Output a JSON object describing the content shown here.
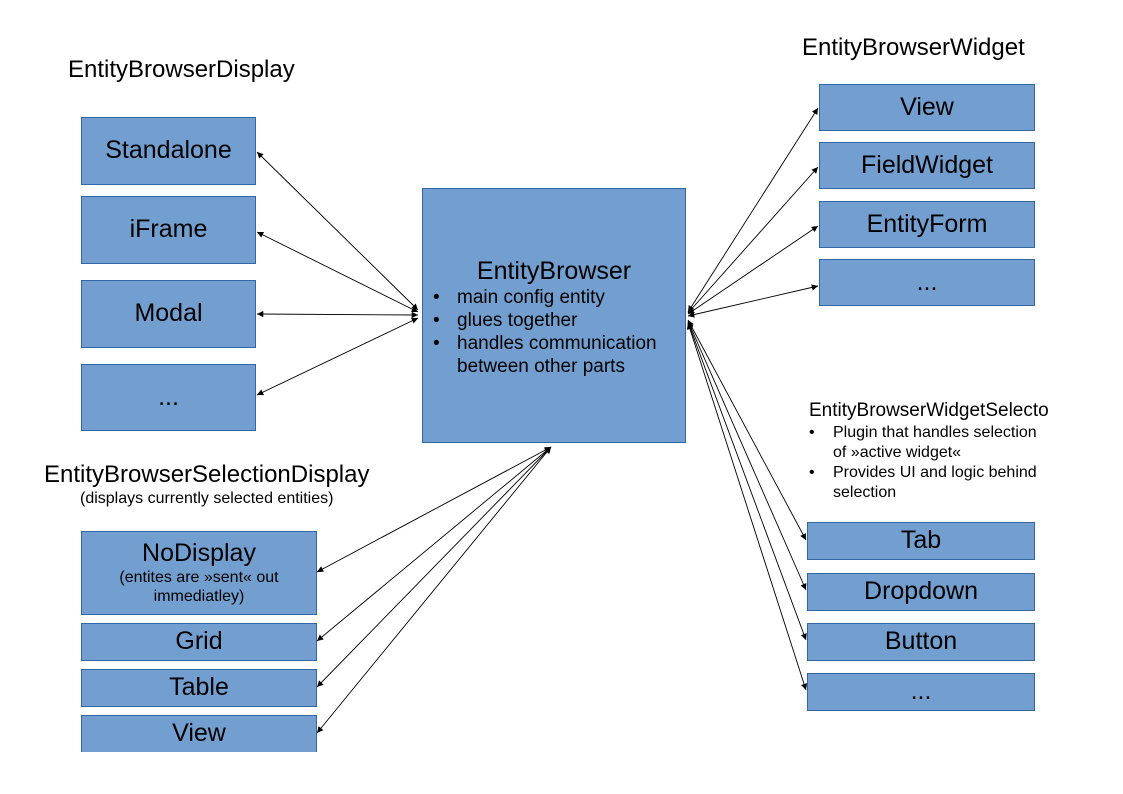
{
  "display_group": {
    "title": "EntityBrowserDisplay",
    "items": [
      "Standalone",
      "iFrame",
      "Modal",
      "..."
    ]
  },
  "center": {
    "title": "EntityBrowser",
    "bullets": [
      "main config entity",
      "glues together",
      "handles communication between other parts"
    ]
  },
  "widget_group": {
    "title": "EntityBrowserWidget",
    "items": [
      "View",
      "FieldWidget",
      "EntityForm",
      "..."
    ]
  },
  "widget_selector_group": {
    "title": "EntityBrowserWidgetSelecto",
    "bullets": [
      "Plugin that handles selection of »active widget«",
      "Provides UI and logic behind selection"
    ],
    "items": [
      "Tab",
      "Dropdown",
      "Button",
      "..."
    ]
  },
  "selection_display_group": {
    "title": "EntityBrowserSelectionDisplay",
    "subtitle": "(displays currently selected entities)",
    "items": [
      {
        "label": "NoDisplay",
        "note": "(entites are »sent« out immediatley)"
      },
      {
        "label": "Grid"
      },
      {
        "label": "Table"
      },
      {
        "label": "View"
      }
    ]
  },
  "bullet_char": "•",
  "colors": {
    "box_fill": "#729fcf",
    "box_border": "#3465a4",
    "arrow": "#000000"
  }
}
